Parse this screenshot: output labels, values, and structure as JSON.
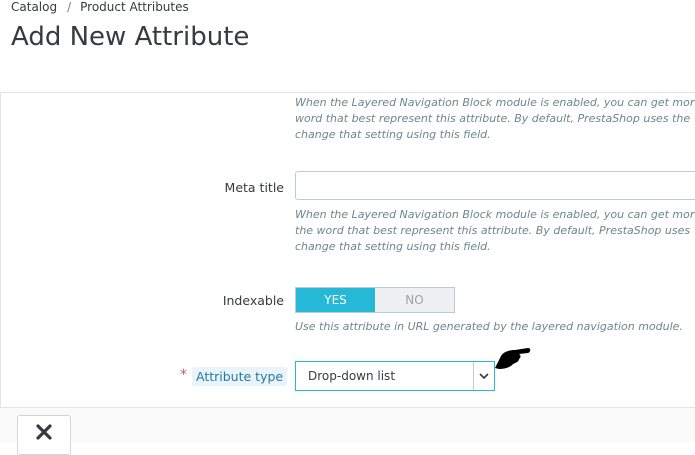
{
  "breadcrumb": {
    "items": [
      "Catalog",
      "Product Attributes"
    ],
    "separator": "/"
  },
  "page": {
    "title": "Add New Attribute"
  },
  "form": {
    "top_help": [
      "When the Layered Navigation Block module is enabled, you can get mor",
      "word that best represent this attribute. By default, PrestaShop uses the",
      "change that setting using this field."
    ],
    "meta_title": {
      "label": "Meta title",
      "value": "",
      "help": [
        "When the Layered Navigation Block module is enabled, you can get mor",
        "the word that best represent this attribute. By default, PrestaShop uses",
        "change that setting using this field."
      ]
    },
    "indexable": {
      "label": "Indexable",
      "yes_label": "YES",
      "no_label": "NO",
      "selected": "YES",
      "help": "Use this attribute in URL generated by the layered navigation module."
    },
    "attribute_type": {
      "required_mark": "*",
      "label": "Attribute type",
      "value": "Drop-down list"
    }
  },
  "footer": {
    "cancel_icon": "close-icon"
  },
  "colors": {
    "accent": "#25b9d7",
    "required": "#c05c67",
    "text": "#363a41",
    "help": "#6c868e"
  }
}
